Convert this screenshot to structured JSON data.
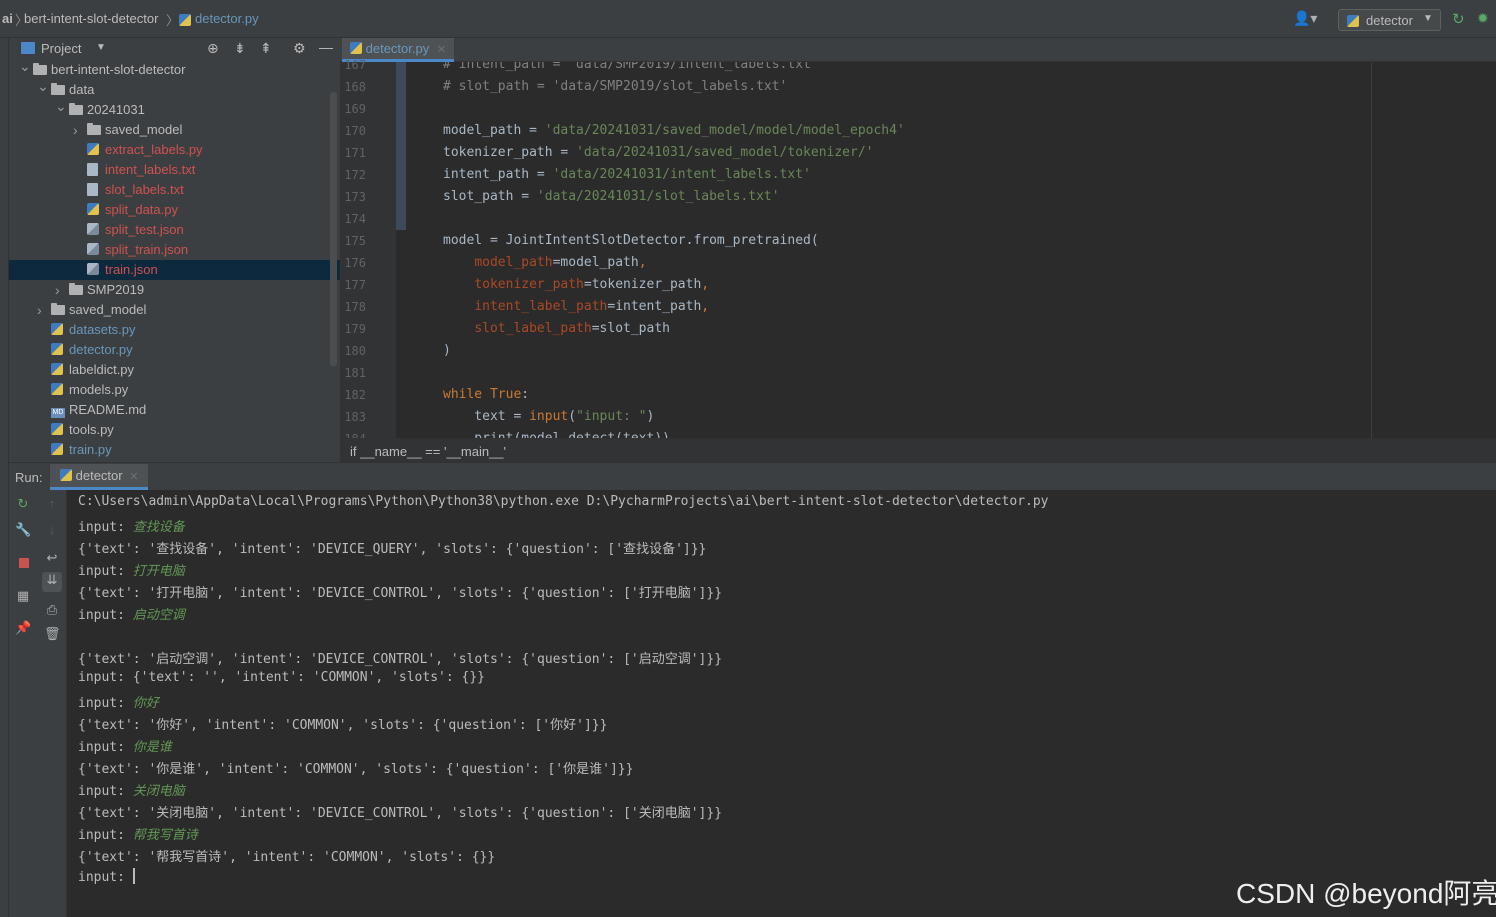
{
  "nav": {
    "root": "ai",
    "project": "bert-intent-slot-detector",
    "file": "detector.py",
    "run_config": "detector"
  },
  "project_panel": {
    "title": "Project",
    "items": [
      {
        "label": "bert-intent-slot-detector",
        "kind": "folder",
        "depth": 0,
        "arrow": "open"
      },
      {
        "label": "data",
        "kind": "folder",
        "depth": 1,
        "arrow": "open"
      },
      {
        "label": "20241031",
        "kind": "folder",
        "depth": 2,
        "arrow": "open"
      },
      {
        "label": "saved_model",
        "kind": "folder",
        "depth": 3,
        "arrow": "closed"
      },
      {
        "label": "extract_labels.py",
        "kind": "py",
        "depth": 3,
        "color": "red"
      },
      {
        "label": "intent_labels.txt",
        "kind": "txt",
        "depth": 3,
        "color": "red"
      },
      {
        "label": "slot_labels.txt",
        "kind": "txt",
        "depth": 3,
        "color": "red"
      },
      {
        "label": "split_data.py",
        "kind": "py",
        "depth": 3,
        "color": "red"
      },
      {
        "label": "split_test.json",
        "kind": "json",
        "depth": 3,
        "color": "red"
      },
      {
        "label": "split_train.json",
        "kind": "json",
        "depth": 3,
        "color": "red"
      },
      {
        "label": "train.json",
        "kind": "json",
        "depth": 3,
        "color": "red",
        "selected": true
      },
      {
        "label": "SMP2019",
        "kind": "folder",
        "depth": 2,
        "arrow": "closed"
      },
      {
        "label": "saved_model",
        "kind": "folder",
        "depth": 1,
        "arrow": "closed"
      },
      {
        "label": "datasets.py",
        "kind": "py",
        "depth": 1,
        "color": "blue"
      },
      {
        "label": "detector.py",
        "kind": "py",
        "depth": 1,
        "color": "blue"
      },
      {
        "label": "labeldict.py",
        "kind": "py",
        "depth": 1
      },
      {
        "label": "models.py",
        "kind": "py",
        "depth": 1
      },
      {
        "label": "README.md",
        "kind": "md",
        "depth": 1
      },
      {
        "label": "tools.py",
        "kind": "py",
        "depth": 1
      },
      {
        "label": "train.py",
        "kind": "py",
        "depth": 1,
        "color": "blue"
      }
    ]
  },
  "editor": {
    "tab": "detector.py",
    "breadcrumb": "if __name__ == '__main__'",
    "lines": [
      {
        "n": "167",
        "t": [
          [
            "cmt",
            "# intent_path = 'data/SMP2019/intent_labels.txt'"
          ]
        ]
      },
      {
        "n": "168",
        "t": [
          [
            "cmt",
            "# slot_path = 'data/SMP2019/slot_labels.txt'"
          ]
        ]
      },
      {
        "n": "169",
        "t": []
      },
      {
        "n": "170",
        "t": [
          [
            "",
            "model_path = "
          ],
          [
            "str",
            "'data/20241031/saved_model/model/model_epoch4'"
          ]
        ]
      },
      {
        "n": "171",
        "t": [
          [
            "",
            "tokenizer_path = "
          ],
          [
            "str",
            "'data/20241031/saved_model/tokenizer/'"
          ]
        ]
      },
      {
        "n": "172",
        "t": [
          [
            "",
            "intent_path = "
          ],
          [
            "str",
            "'data/20241031/intent_labels.txt'"
          ]
        ]
      },
      {
        "n": "173",
        "t": [
          [
            "",
            "slot_path = "
          ],
          [
            "str",
            "'data/20241031/slot_labels.txt'"
          ]
        ]
      },
      {
        "n": "174",
        "t": []
      },
      {
        "n": "175",
        "t": [
          [
            "",
            "model = JointIntentSlotDetector.from_pretrained("
          ]
        ]
      },
      {
        "n": "176",
        "t": [
          [
            "",
            "    "
          ],
          [
            "par",
            "model_path"
          ],
          [
            "",
            "=model_path"
          ],
          [
            "kw",
            ","
          ]
        ]
      },
      {
        "n": "177",
        "t": [
          [
            "",
            "    "
          ],
          [
            "par",
            "tokenizer_path"
          ],
          [
            "",
            "=tokenizer_path"
          ],
          [
            "kw",
            ","
          ]
        ]
      },
      {
        "n": "178",
        "t": [
          [
            "",
            "    "
          ],
          [
            "par",
            "intent_label_path"
          ],
          [
            "",
            "=intent_path"
          ],
          [
            "kw",
            ","
          ]
        ]
      },
      {
        "n": "179",
        "t": [
          [
            "",
            "    "
          ],
          [
            "par",
            "slot_label_path"
          ],
          [
            "",
            "=slot_path"
          ]
        ]
      },
      {
        "n": "180",
        "t": [
          [
            "",
            ")"
          ]
        ]
      },
      {
        "n": "181",
        "t": []
      },
      {
        "n": "182",
        "t": [
          [
            "kw",
            "while True"
          ],
          [
            "",
            ":"
          ]
        ]
      },
      {
        "n": "183",
        "t": [
          [
            "",
            "    text = "
          ],
          [
            "kw",
            "input"
          ],
          [
            "",
            "("
          ],
          [
            "str",
            "\"input: \""
          ],
          [
            "",
            ")"
          ]
        ]
      },
      {
        "n": "184",
        "t": [
          [
            "",
            "    print(model.detect(text))"
          ]
        ]
      }
    ]
  },
  "run": {
    "label": "Run:",
    "tab": "detector",
    "lines": [
      {
        "t": "C:\\Users\\admin\\AppData\\Local\\Programs\\Python\\Python38\\python.exe D:\\PycharmProjects\\ai\\bert-intent-slot-detector\\detector.py"
      },
      {
        "t": "input: ",
        "u": "查找设备"
      },
      {
        "t": "{'text': '查找设备', 'intent': 'DEVICE_QUERY', 'slots': {'question': ['查找设备']}}"
      },
      {
        "t": "input: ",
        "u": "打开电脑"
      },
      {
        "t": "{'text': '打开电脑', 'intent': 'DEVICE_CONTROL', 'slots': {'question': ['打开电脑']}}"
      },
      {
        "t": "input: ",
        "u": "启动空调"
      },
      {
        "t": ""
      },
      {
        "t": "{'text': '启动空调', 'intent': 'DEVICE_CONTROL', 'slots': {'question': ['启动空调']}}"
      },
      {
        "t": "input: {'text': '', 'intent': 'COMMON', 'slots': {}}"
      },
      {
        "t": "input: ",
        "u": "你好"
      },
      {
        "t": "{'text': '你好', 'intent': 'COMMON', 'slots': {'question': ['你好']}}"
      },
      {
        "t": "input: ",
        "u": "你是谁"
      },
      {
        "t": "{'text': '你是谁', 'intent': 'COMMON', 'slots': {'question': ['你是谁']}}"
      },
      {
        "t": "input: ",
        "u": "关闭电脑"
      },
      {
        "t": "{'text': '关闭电脑', 'intent': 'DEVICE_CONTROL', 'slots': {'question': ['关闭电脑']}}"
      },
      {
        "t": "input: ",
        "u": "帮我写首诗"
      },
      {
        "t": "{'text': '帮我写首诗', 'intent': 'COMMON', 'slots': {}}"
      },
      {
        "t": "input: ",
        "cursor": true
      }
    ]
  },
  "watermark": "CSDN @beyond阿亮"
}
